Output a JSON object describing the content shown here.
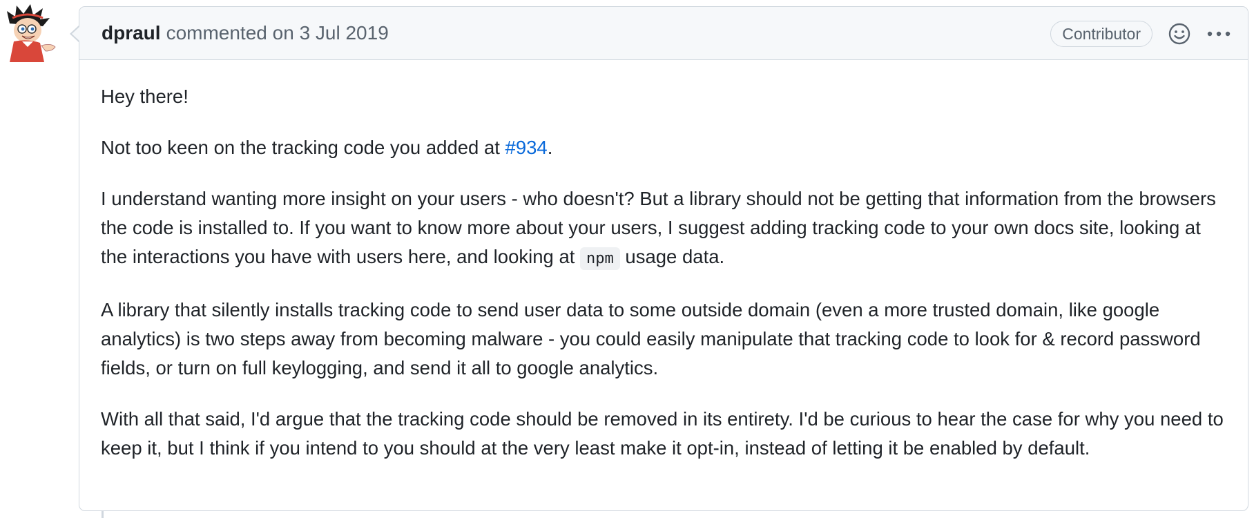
{
  "comment": {
    "author": "dpraul",
    "action": "commented on",
    "date": "3 Jul 2019",
    "role_badge": "Contributor",
    "icons": {
      "avatar": "cartoon-avatar",
      "reaction": "smiley-icon",
      "more": "kebab-horizontal-icon"
    },
    "body": {
      "p1": "Hey there!",
      "p2_prefix": "Not too keen on the tracking code you added at ",
      "p2_link": "#934",
      "p2_suffix": ".",
      "p3_prefix": "I understand wanting more insight on your users - who doesn't? But a library should not be getting that information from the browsers the code is installed to. If you want to know more about your users, I suggest adding tracking code to your own docs site, looking at the interactions you have with users here, and looking at ",
      "p3_code": "npm",
      "p3_suffix": " usage data.",
      "p4": "A library that silently installs tracking code to send user data to some outside domain (even a more trusted domain, like google analytics) is two steps away from becoming malware - you could easily manipulate that tracking code to look for & record password fields, or turn on full keylogging, and send it all to google analytics.",
      "p5": "With all that said, I'd argue that the tracking code should be removed in its entirety. I'd be curious to hear the case for why you need to keep it, but I think if you intend to you should at the very least make it opt-in, instead of letting it be enabled by default."
    }
  },
  "colors": {
    "link": "#0969da",
    "border": "#d0d7de",
    "header_bg": "#f6f8fa",
    "muted_text": "#59636e"
  }
}
